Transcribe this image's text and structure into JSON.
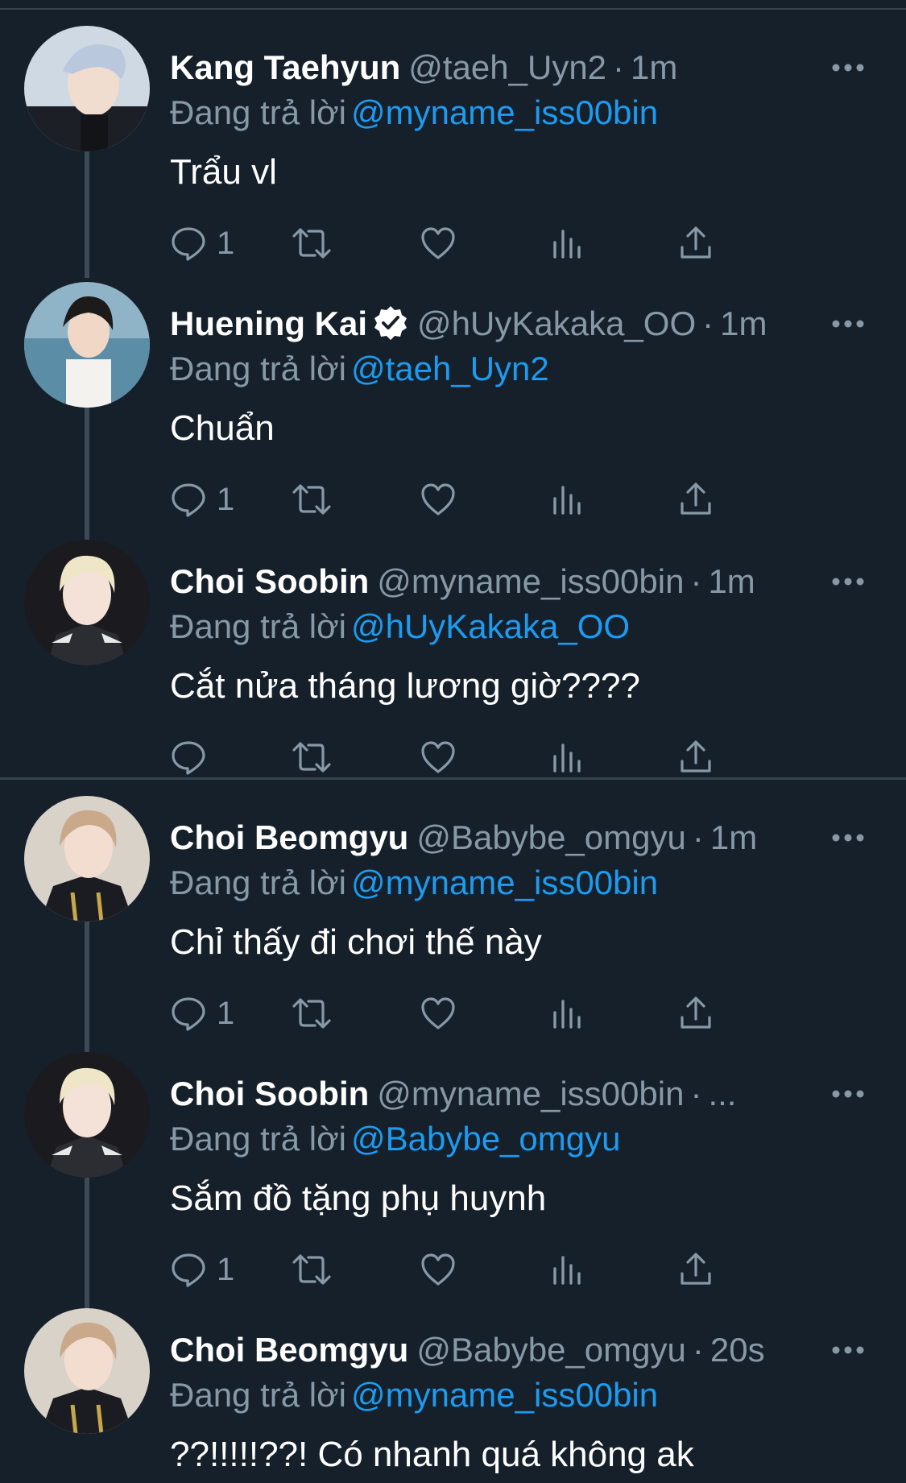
{
  "colors": {
    "background": "#15202b",
    "name": "#ffffff",
    "secondary_text": "#8899a6",
    "mention": "#1d9bf0",
    "thread_line": "#3d4a55",
    "divider": "#38444d"
  },
  "reply_prefix": "Đang trả lời",
  "tweets": [
    {
      "name": "Kang Taehyun",
      "handle": "@taeh_Uyn2",
      "dot": "·",
      "time": "1m",
      "verified": false,
      "reply_to": "@myname_iss00bin",
      "text": "Trẩu vl",
      "reply_count": "1",
      "avatar_icon": "avatar-silver-hair"
    },
    {
      "name": "Huening Kai",
      "handle": "@hUyKakaka_OO",
      "dot": "·",
      "time": "1m",
      "verified": true,
      "reply_to": "@taeh_Uyn2",
      "text": "Chuẩn",
      "reply_count": "1",
      "avatar_icon": "avatar-dark-hair-sea"
    },
    {
      "name": "Choi Soobin",
      "handle": "@myname_iss00bin",
      "dot": "·",
      "time": "1m",
      "verified": false,
      "reply_to": "@hUyKakaka_OO",
      "text": "Cắt nửa tháng lương giờ????",
      "reply_count": "",
      "avatar_icon": "avatar-blond-hair"
    },
    {
      "name": "Choi Beomgyu",
      "handle": "@Babybe_omgyu",
      "dot": "·",
      "time": "1m",
      "verified": false,
      "reply_to": "@myname_iss00bin",
      "text": "Chỉ thấy đi chơi thế này",
      "reply_count": "1",
      "avatar_icon": "avatar-light-brown-hair"
    },
    {
      "name": "Choi Soobin",
      "handle": "@myname_iss00bin",
      "dot": "·",
      "time": "...",
      "verified": false,
      "reply_to": "@Babybe_omgyu",
      "text": "Sắm đồ tặng phụ huynh",
      "reply_count": "1",
      "avatar_icon": "avatar-blond-hair"
    },
    {
      "name": "Choi Beomgyu",
      "handle": "@Babybe_omgyu",
      "dot": "·",
      "time": "20s",
      "verified": false,
      "reply_to": "@myname_iss00bin",
      "text": "??!!!!!??! Có nhanh quá không ak",
      "reply_count": "",
      "avatar_icon": "avatar-light-brown-hair"
    }
  ],
  "action_icons": [
    "reply-icon",
    "retweet-icon",
    "like-icon",
    "analytics-icon",
    "share-icon"
  ]
}
